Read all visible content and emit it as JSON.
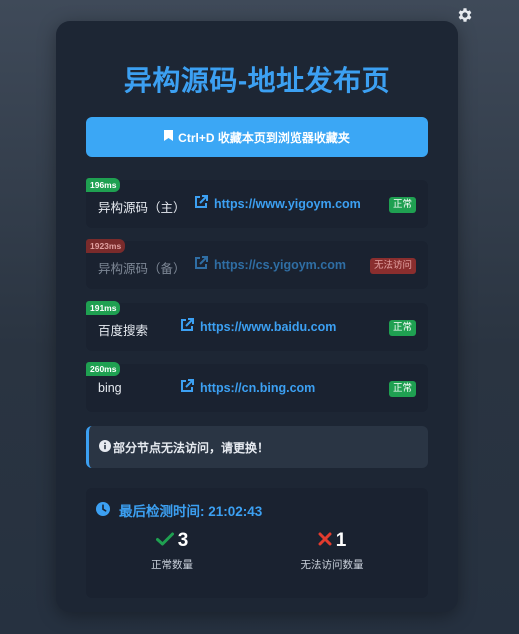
{
  "page": {
    "title": "异构源码-地址发布页",
    "bookmark_label": "Ctrl+D 收藏本页到浏览器收藏夹"
  },
  "sites": [
    {
      "latency": "196ms",
      "name": "异构源码（主）",
      "url": "https://www.yigoym.com",
      "status": "正常",
      "ok": true
    },
    {
      "latency": "1923ms",
      "name": "异构源码（备）",
      "url": "https://cs.yigoym.com",
      "status": "无法访问",
      "ok": false
    },
    {
      "latency": "191ms",
      "name": "百度搜索",
      "url": "https://www.baidu.com",
      "status": "正常",
      "ok": true
    },
    {
      "latency": "260ms",
      "name": "bing",
      "url": "https://cn.bing.com",
      "status": "正常",
      "ok": true
    }
  ],
  "notice": "部分节点无法访问，请更换！",
  "stats": {
    "check_time_label": "最后检测时间: 21:02:43",
    "ok_count": "3",
    "ok_label": "正常数量",
    "fail_count": "1",
    "fail_label": "无法访问数量"
  },
  "colors": {
    "accent": "#3ca0f2",
    "ok": "#1fa051",
    "fail": "#e23b2e"
  },
  "icons": {
    "settings": "gear-icon",
    "bookmark": "bookmark-icon",
    "external": "external-link-icon",
    "info": "info-icon",
    "clock": "clock-icon",
    "check": "check-icon",
    "cross": "cross-icon"
  }
}
